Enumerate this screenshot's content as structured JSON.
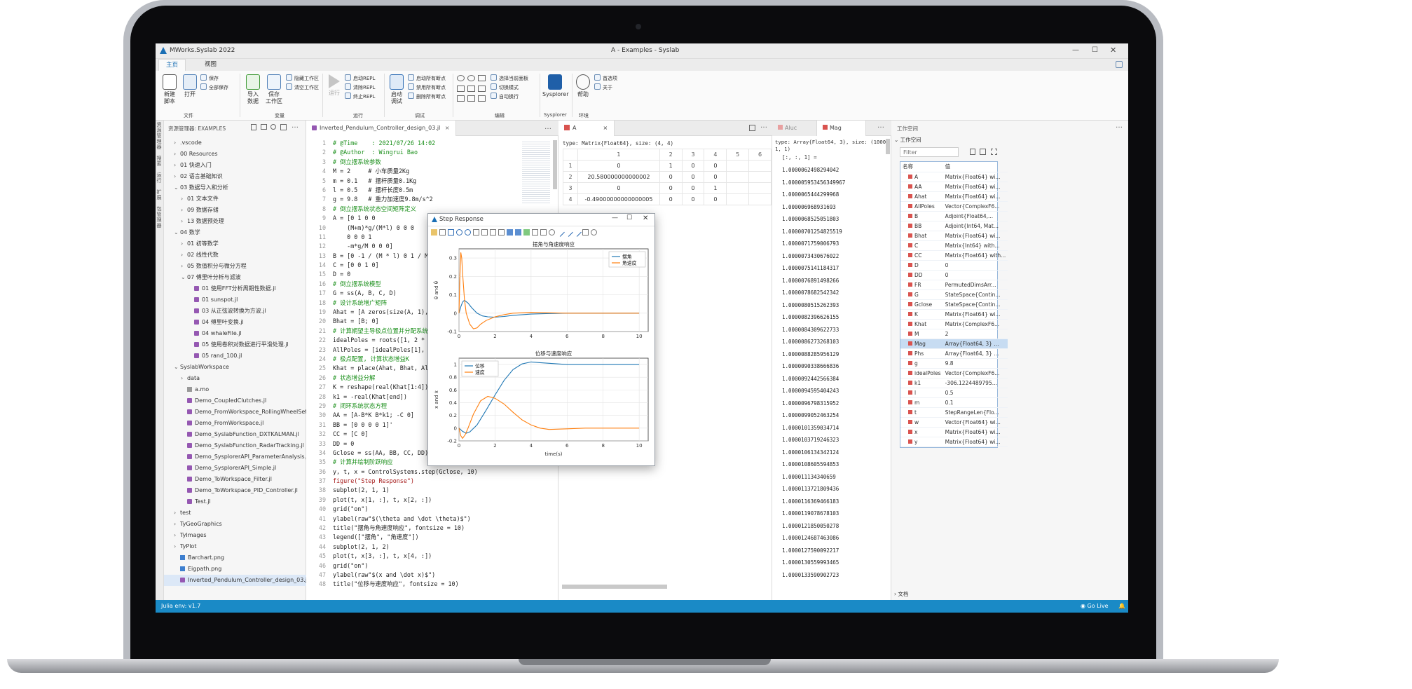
{
  "app": {
    "title": "MWorks.Syslab 2022",
    "window_title": "A - Examples - Syslab"
  },
  "ribbon": {
    "tabs": [
      "主页",
      "视图"
    ],
    "buttons": [
      {
        "label": "新建\n脚本"
      },
      {
        "label": "打开"
      },
      {
        "label": "导入\n数据"
      },
      {
        "label": "保存\n工作区"
      },
      {
        "label": "运行"
      },
      {
        "label": "启动\n调试"
      },
      {
        "label": "Sysplorer"
      },
      {
        "label": "帮助"
      }
    ],
    "small_items": [
      "保存",
      "全部保存",
      "隐藏工作区",
      "清空工作区",
      "启动REPL",
      "清除REPL",
      "终止REPL",
      "启动所有断点",
      "禁用所有断点",
      "删除所有断点",
      "选择当前面板",
      "切换模式",
      "自动换行",
      "首选项",
      "关于"
    ],
    "groups": [
      "文件",
      "变量",
      "运行",
      "调试",
      "编辑",
      "Sysplorer",
      "环境"
    ]
  },
  "activity": {
    "labels": [
      "资源管理器",
      "搜索",
      "运行",
      "扩展",
      "包管理器"
    ]
  },
  "explorer": {
    "title": "资源管理器: EXAMPLES",
    "items": [
      {
        "label": ".vscode",
        "level": 1,
        "arrow": "›",
        "icon": ""
      },
      {
        "label": "00 Resources",
        "level": 1,
        "arrow": "›",
        "icon": ""
      },
      {
        "label": "01 快速入门",
        "level": 1,
        "arrow": "›",
        "icon": ""
      },
      {
        "label": "02 语言基础知识",
        "level": 1,
        "arrow": "›",
        "icon": ""
      },
      {
        "label": "03 数据导入和分析",
        "level": 1,
        "arrow": "⌄",
        "icon": ""
      },
      {
        "label": "01 文本文件",
        "level": 2,
        "arrow": "›",
        "icon": ""
      },
      {
        "label": "09 数据存储",
        "level": 2,
        "arrow": "›",
        "icon": ""
      },
      {
        "label": "13 数据预处理",
        "level": 2,
        "arrow": "›",
        "icon": ""
      },
      {
        "label": "04 数学",
        "level": 1,
        "arrow": "⌄",
        "icon": ""
      },
      {
        "label": "01 初等数学",
        "level": 2,
        "arrow": "›",
        "icon": ""
      },
      {
        "label": "02 线性代数",
        "level": 2,
        "arrow": "›",
        "icon": ""
      },
      {
        "label": "05 数值积分与微分方程",
        "level": 2,
        "arrow": "›",
        "icon": ""
      },
      {
        "label": "07 傅里叶分析与滤波",
        "level": 2,
        "arrow": "⌄",
        "icon": ""
      },
      {
        "label": "01 使用FFT分析周期性数据.jl",
        "level": 3,
        "arrow": "",
        "icon": "jl"
      },
      {
        "label": "01 sunspot.jl",
        "level": 3,
        "arrow": "",
        "icon": "jl"
      },
      {
        "label": "03 从正弦波转换为方波.jl",
        "level": 3,
        "arrow": "",
        "icon": "jl"
      },
      {
        "label": "04 傅里叶变换.jl",
        "level": 3,
        "arrow": "",
        "icon": "jl"
      },
      {
        "label": "04 whaleFile.jl",
        "level": 3,
        "arrow": "",
        "icon": "jl"
      },
      {
        "label": "05 使用卷积对数据进行平滑处理.jl",
        "level": 3,
        "arrow": "",
        "icon": "jl"
      },
      {
        "label": "05 rand_100.jl",
        "level": 3,
        "arrow": "",
        "icon": "jl"
      },
      {
        "label": "SyslabWorkspace",
        "level": 1,
        "arrow": "⌄",
        "icon": ""
      },
      {
        "label": "data",
        "level": 2,
        "arrow": "›",
        "icon": ""
      },
      {
        "label": "a.mo",
        "level": 2,
        "arrow": "",
        "icon": "mo"
      },
      {
        "label": "Demo_CoupledClutches.jl",
        "level": 2,
        "arrow": "",
        "icon": "jl"
      },
      {
        "label": "Demo_FromWorkspace_RollingWheelSetPulling.jl",
        "level": 2,
        "arrow": "",
        "icon": "jl"
      },
      {
        "label": "Demo_FromWorkspace.jl",
        "level": 2,
        "arrow": "",
        "icon": "jl"
      },
      {
        "label": "Demo_SyslabFunction_DXTKALMAN.jl",
        "level": 2,
        "arrow": "",
        "icon": "jl"
      },
      {
        "label": "Demo_SyslabFunction_RadarTracking.jl",
        "level": 2,
        "arrow": "",
        "icon": "jl"
      },
      {
        "label": "Demo_SysplorerAPI_ParameterAnalysis.jl",
        "level": 2,
        "arrow": "",
        "icon": "jl"
      },
      {
        "label": "Demo_SysplorerAPI_Simple.jl",
        "level": 2,
        "arrow": "",
        "icon": "jl"
      },
      {
        "label": "Demo_ToWorkspace_Filter.jl",
        "level": 2,
        "arrow": "",
        "icon": "jl"
      },
      {
        "label": "Demo_ToWorkspace_PID_Controller.jl",
        "level": 2,
        "arrow": "",
        "icon": "jl"
      },
      {
        "label": "Test.jl",
        "level": 2,
        "arrow": "",
        "icon": "jl"
      },
      {
        "label": "test",
        "level": 1,
        "arrow": "›",
        "icon": ""
      },
      {
        "label": "TyGeoGraphics",
        "level": 1,
        "arrow": "›",
        "icon": ""
      },
      {
        "label": "TyImages",
        "level": 1,
        "arrow": "›",
        "icon": ""
      },
      {
        "label": "TyPlot",
        "level": 1,
        "arrow": "›",
        "icon": ""
      },
      {
        "label": "Barchart.png",
        "level": 1,
        "arrow": "",
        "icon": "png"
      },
      {
        "label": "Eigpath.png",
        "level": 1,
        "arrow": "",
        "icon": "png"
      },
      {
        "label": "Inverted_Pendulum_Controller_design_03.jl",
        "level": 1,
        "arrow": "",
        "icon": "jl",
        "selected": true
      }
    ]
  },
  "editor": {
    "tab": "Inverted_Pendulum_Controller_design_03.jl",
    "lines": [
      {
        "n": "1",
        "t": "# @Time    : 2021/07/26 14:02",
        "c": "cm"
      },
      {
        "n": "2",
        "t": "# @Author  : Wingrui Bao",
        "c": "cm"
      },
      {
        "n": "3",
        "t": "# 倒立摆系统参数",
        "c": "cm"
      },
      {
        "n": "4",
        "t": "M = 2     # 小车质量2Kg",
        "c": ""
      },
      {
        "n": "5",
        "t": "m = 0.1   # 摆杆质量0.1Kg",
        "c": ""
      },
      {
        "n": "6",
        "t": "l = 0.5   # 摆杆长度0.5m",
        "c": ""
      },
      {
        "n": "7",
        "t": "g = 9.8   # 重力加速度9.8m/s^2",
        "c": ""
      },
      {
        "n": "8",
        "t": "# 倒立摆系统状态空间矩阵定义",
        "c": "cm"
      },
      {
        "n": "9",
        "t": "A = [0 1 0 0",
        "c": ""
      },
      {
        "n": "10",
        "t": "    (M+m)*g/(M*l) 0 0 0",
        "c": ""
      },
      {
        "n": "11",
        "t": "    0 0 0 1",
        "c": ""
      },
      {
        "n": "12",
        "t": "    -m*g/M 0 0 0]",
        "c": ""
      },
      {
        "n": "13",
        "t": "B = [0 -1 / (M * l) 0 1 / M]'",
        "c": ""
      },
      {
        "n": "14",
        "t": "C = [0 0 1 0]",
        "c": ""
      },
      {
        "n": "15",
        "t": "D = 0",
        "c": ""
      },
      {
        "n": "16",
        "t": "# 倒立摆系统模型",
        "c": "cm"
      },
      {
        "n": "17",
        "t": "G = ss(A, B, C, D)",
        "c": ""
      },
      {
        "n": "18",
        "t": "# 设计系统增广矩阵",
        "c": "cm"
      },
      {
        "n": "19",
        "t": "Ahat = [A zeros(size(A, 1), 1); -C 0]",
        "c": ""
      },
      {
        "n": "20",
        "t": "Bhat = [B; 0]",
        "c": ""
      },
      {
        "n": "21",
        "t": "# 计算期望主导极点位置并分配系统所有极点位置",
        "c": "cm"
      },
      {
        "n": "22",
        "t": "idealPoles = roots([1, 2 * 0.7 * 1, 1])",
        "c": ""
      },
      {
        "n": "23",
        "t": "AllPoles = [idealPoles[1], idealPoles[2], -10, -",
        "c": ""
      },
      {
        "n": "24",
        "t": "# 极点配置, 计算状态增益K",
        "c": "cm"
      },
      {
        "n": "25",
        "t": "Khat = place(Ahat, Bhat, AllPoles)",
        "c": ""
      },
      {
        "n": "26",
        "t": "# 状态增益分解",
        "c": "cm"
      },
      {
        "n": "27",
        "t": "K = reshape(real(Khat[1:4]), 1, 4)",
        "c": ""
      },
      {
        "n": "28",
        "t": "k1 = -real(Khat[end])",
        "c": ""
      },
      {
        "n": "29",
        "t": "# 闭环系统状态方程",
        "c": "cm"
      },
      {
        "n": "30",
        "t": "AA = [A-B*K B*k1; -C 0]",
        "c": ""
      },
      {
        "n": "31",
        "t": "BB = [0 0 0 0 1]'",
        "c": ""
      },
      {
        "n": "32",
        "t": "CC = [C 0]",
        "c": ""
      },
      {
        "n": "33",
        "t": "DD = 0",
        "c": ""
      },
      {
        "n": "34",
        "t": "Gclose = ss(AA, BB, CC, DD)",
        "c": ""
      },
      {
        "n": "35",
        "t": "# 计算并绘制阶跃响应",
        "c": "cm"
      },
      {
        "n": "36",
        "t": "y, t, x = ControlSystems.step(Gclose, 10)",
        "c": ""
      },
      {
        "n": "37",
        "t": "figure(\"Step Response\")",
        "c": "st"
      },
      {
        "n": "38",
        "t": "subplot(2, 1, 1)",
        "c": ""
      },
      {
        "n": "39",
        "t": "plot(t, x[1, :], t, x[2, :])",
        "c": ""
      },
      {
        "n": "40",
        "t": "grid(\"on\")",
        "c": ""
      },
      {
        "n": "41",
        "t": "ylabel(raw\"$(\\theta and \\dot \\theta)$\")",
        "c": ""
      },
      {
        "n": "42",
        "t": "title(\"摆角与角速度响应\", fontsize = 10)",
        "c": ""
      },
      {
        "n": "43",
        "t": "legend([\"摆角\", \"角速度\"])",
        "c": ""
      },
      {
        "n": "44",
        "t": "subplot(2, 1, 2)",
        "c": ""
      },
      {
        "n": "45",
        "t": "plot(t, x[3, :], t, x[4, :])",
        "c": ""
      },
      {
        "n": "46",
        "t": "grid(\"on\")",
        "c": ""
      },
      {
        "n": "47",
        "t": "ylabel(raw\"$(x and \\dot x)$\")",
        "c": ""
      },
      {
        "n": "48",
        "t": "title(\"位移与速度响应\", fontsize = 10)",
        "c": ""
      }
    ]
  },
  "dataframe": {
    "tab": "A",
    "type_line": "type: Matrix{Float64}, size: (4, 4)",
    "col_headers": [
      "1",
      "2",
      "3",
      "4",
      "5",
      "6"
    ],
    "rows": [
      {
        "i": "1",
        "v": [
          "0",
          "1",
          "0",
          "0"
        ]
      },
      {
        "i": "2",
        "v": [
          "20.580000000000002",
          "0",
          "0",
          "0"
        ]
      },
      {
        "i": "3",
        "v": [
          "0",
          "0",
          "0",
          "1"
        ]
      },
      {
        "i": "4",
        "v": [
          "-0.49000000000000005",
          "0",
          "0",
          "0"
        ]
      }
    ]
  },
  "array_panel": {
    "tabs": [
      "Aluc",
      "Mag"
    ],
    "header": "type: Array{Float64, 3}, size: (1000, 1, 1)",
    "slice": "[:, :, 1] =",
    "values": [
      "1.0000062498294042",
      "1.000005953456349967",
      "1.0000065444299968",
      "1.000006968931693",
      "1.0000068525051803",
      "1.00000701254825519",
      "1.0000071759006793",
      "1.0000073430676022",
      "1.0000075141184317",
      "1.0000076891498266",
      "1.0000078682542342",
      "1.0000080515262393",
      "1.0000082396626155",
      "1.0000084309622733",
      "1.0000086273268103",
      "1.0000088285956129",
      "1.0000090338666836",
      "1.0000092442566384",
      "1.0000094595404243",
      "1.0000096798315952",
      "1.0000099052463254",
      "1.0000101359034714",
      "1.0000103719246323",
      "1.0000106134342124",
      "1.0000108605594853",
      "1.000011134340659",
      "1.0000113721809436",
      "1.0000116369466183",
      "1.0000119078678103",
      "1.0000121850050278",
      "1.0000124687463086",
      "1.0000127590092217",
      "1.0000130559993465",
      "1.0000133590902723"
    ]
  },
  "workspace": {
    "title": "工作空间",
    "section": "工作空间",
    "filter_placeholder": "Filter",
    "col_name": "名称",
    "col_value": "值",
    "footer": "文档",
    "vars": [
      {
        "name": "A",
        "value": "Matrix{Float64} wi..."
      },
      {
        "name": "AA",
        "value": "Matrix{Float64} wi..."
      },
      {
        "name": "Ahat",
        "value": "Matrix{Float64} wi..."
      },
      {
        "name": "AllPoles",
        "value": "Vector{ComplexF6..."
      },
      {
        "name": "B",
        "value": "Adjoint{Float64,..."
      },
      {
        "name": "BB",
        "value": "Adjoint{Int64, Mat..."
      },
      {
        "name": "Bhat",
        "value": "Matrix{Float64} wi..."
      },
      {
        "name": "C",
        "value": "Matrix{Int64} with..."
      },
      {
        "name": "CC",
        "value": "Matrix{Float64} with..."
      },
      {
        "name": "D",
        "value": "0"
      },
      {
        "name": "DD",
        "value": "0"
      },
      {
        "name": "FR",
        "value": "PermutedDimsArr..."
      },
      {
        "name": "G",
        "value": "StateSpace{Contin..."
      },
      {
        "name": "Gclose",
        "value": "StateSpace{Contin..."
      },
      {
        "name": "K",
        "value": "Matrix{Float64} wi..."
      },
      {
        "name": "Khat",
        "value": "Matrix{ComplexF6..."
      },
      {
        "name": "M",
        "value": "2"
      },
      {
        "name": "Mag",
        "value": "Array{Float64, 3} ...",
        "selected": true
      },
      {
        "name": "Phs",
        "value": "Array{Float64, 3} ..."
      },
      {
        "name": "g",
        "value": "9.8"
      },
      {
        "name": "idealPoles",
        "value": "Vector{ComplexF6..."
      },
      {
        "name": "k1",
        "value": "-306.1224489795..."
      },
      {
        "name": "l",
        "value": "0.5"
      },
      {
        "name": "m",
        "value": "0.1"
      },
      {
        "name": "t",
        "value": "StepRangeLen{Flo..."
      },
      {
        "name": "w",
        "value": "Vector{Float64} wi..."
      },
      {
        "name": "x",
        "value": "Matrix{Float64} wi..."
      },
      {
        "name": "y",
        "value": "Matrix{Float64} wi..."
      }
    ]
  },
  "statusbar": {
    "left": "Julia env: v1.7",
    "go_live": "Go Live"
  },
  "step_window": {
    "title": "Step Response",
    "chart1_title": "摆角与角速度响应",
    "chart1_ylabel": "θ and θ̇",
    "chart1_legend": [
      "摆角",
      "角速度"
    ],
    "chart2_title": "位移与速度响应",
    "chart2_ylabel": "x and ẋ",
    "chart2_legend": [
      "位移",
      "速度"
    ],
    "xlabel": "time(s)",
    "colors": {
      "series1": "#1f77b4",
      "series2": "#ff7f0e"
    }
  },
  "chart_data": [
    {
      "type": "line",
      "title": "摆角与角速度响应",
      "xlabel": "",
      "ylabel": "θ and θ̇",
      "xlim": [
        0,
        10.5
      ],
      "ylim": [
        -0.1,
        0.35
      ],
      "xticks": [
        0,
        2,
        4,
        6,
        8,
        10
      ],
      "yticks": [
        -0.1,
        0,
        0.1,
        0.2,
        0.3
      ],
      "grid": true,
      "legend": "top-right",
      "series": [
        {
          "name": "摆角",
          "x": [
            0,
            0.1,
            0.2,
            0.3,
            0.5,
            0.7,
            1,
            1.3,
            1.6,
            2,
            2.5,
            3,
            4,
            5,
            6,
            7,
            8,
            10
          ],
          "y": [
            0,
            0.035,
            0.06,
            0.07,
            0.055,
            0.03,
            0.0,
            -0.015,
            -0.02,
            -0.022,
            -0.018,
            -0.012,
            -0.005,
            -0.002,
            0,
            0,
            0,
            0
          ]
        },
        {
          "name": "角速度",
          "x": [
            0,
            0.05,
            0.1,
            0.15,
            0.2,
            0.3,
            0.4,
            0.6,
            0.8,
            1,
            1.2,
            1.5,
            2,
            2.5,
            3,
            4,
            5,
            6,
            8,
            10
          ],
          "y": [
            0,
            0.2,
            0.33,
            0.3,
            0.22,
            0.08,
            0.0,
            -0.06,
            -0.085,
            -0.08,
            -0.06,
            -0.04,
            -0.02,
            -0.008,
            0,
            0.004,
            0.002,
            0,
            0,
            0
          ]
        }
      ]
    },
    {
      "type": "line",
      "title": "位移与速度响应",
      "xlabel": "time(s)",
      "ylabel": "x and ẋ",
      "xlim": [
        0,
        10.5
      ],
      "ylim": [
        -0.2,
        1.1
      ],
      "xticks": [
        0,
        2,
        4,
        6,
        8,
        10
      ],
      "yticks": [
        -0.2,
        0,
        0.2,
        0.4,
        0.6,
        0.8,
        1.0
      ],
      "grid": true,
      "legend": "top-left",
      "series": [
        {
          "name": "位移",
          "x": [
            0,
            0.2,
            0.4,
            0.6,
            1,
            1.5,
            2,
            2.5,
            3,
            3.5,
            4,
            4.5,
            5,
            6,
            7,
            8,
            10
          ],
          "y": [
            0,
            -0.05,
            -0.08,
            -0.06,
            0.05,
            0.28,
            0.52,
            0.75,
            0.92,
            1.01,
            1.04,
            1.03,
            1.02,
            1.0,
            1.0,
            1.0,
            1.0
          ]
        },
        {
          "name": "速度",
          "x": [
            0,
            0.1,
            0.2,
            0.35,
            0.5,
            0.8,
            1.2,
            1.6,
            2,
            2.5,
            3,
            3.5,
            4,
            4.5,
            5,
            6,
            7,
            8,
            10
          ],
          "y": [
            0,
            -0.12,
            -0.16,
            -0.1,
            0.0,
            0.22,
            0.43,
            0.5,
            0.47,
            0.38,
            0.25,
            0.13,
            0.05,
            0.0,
            -0.02,
            -0.01,
            0,
            0,
            0
          ]
        }
      ]
    }
  ]
}
